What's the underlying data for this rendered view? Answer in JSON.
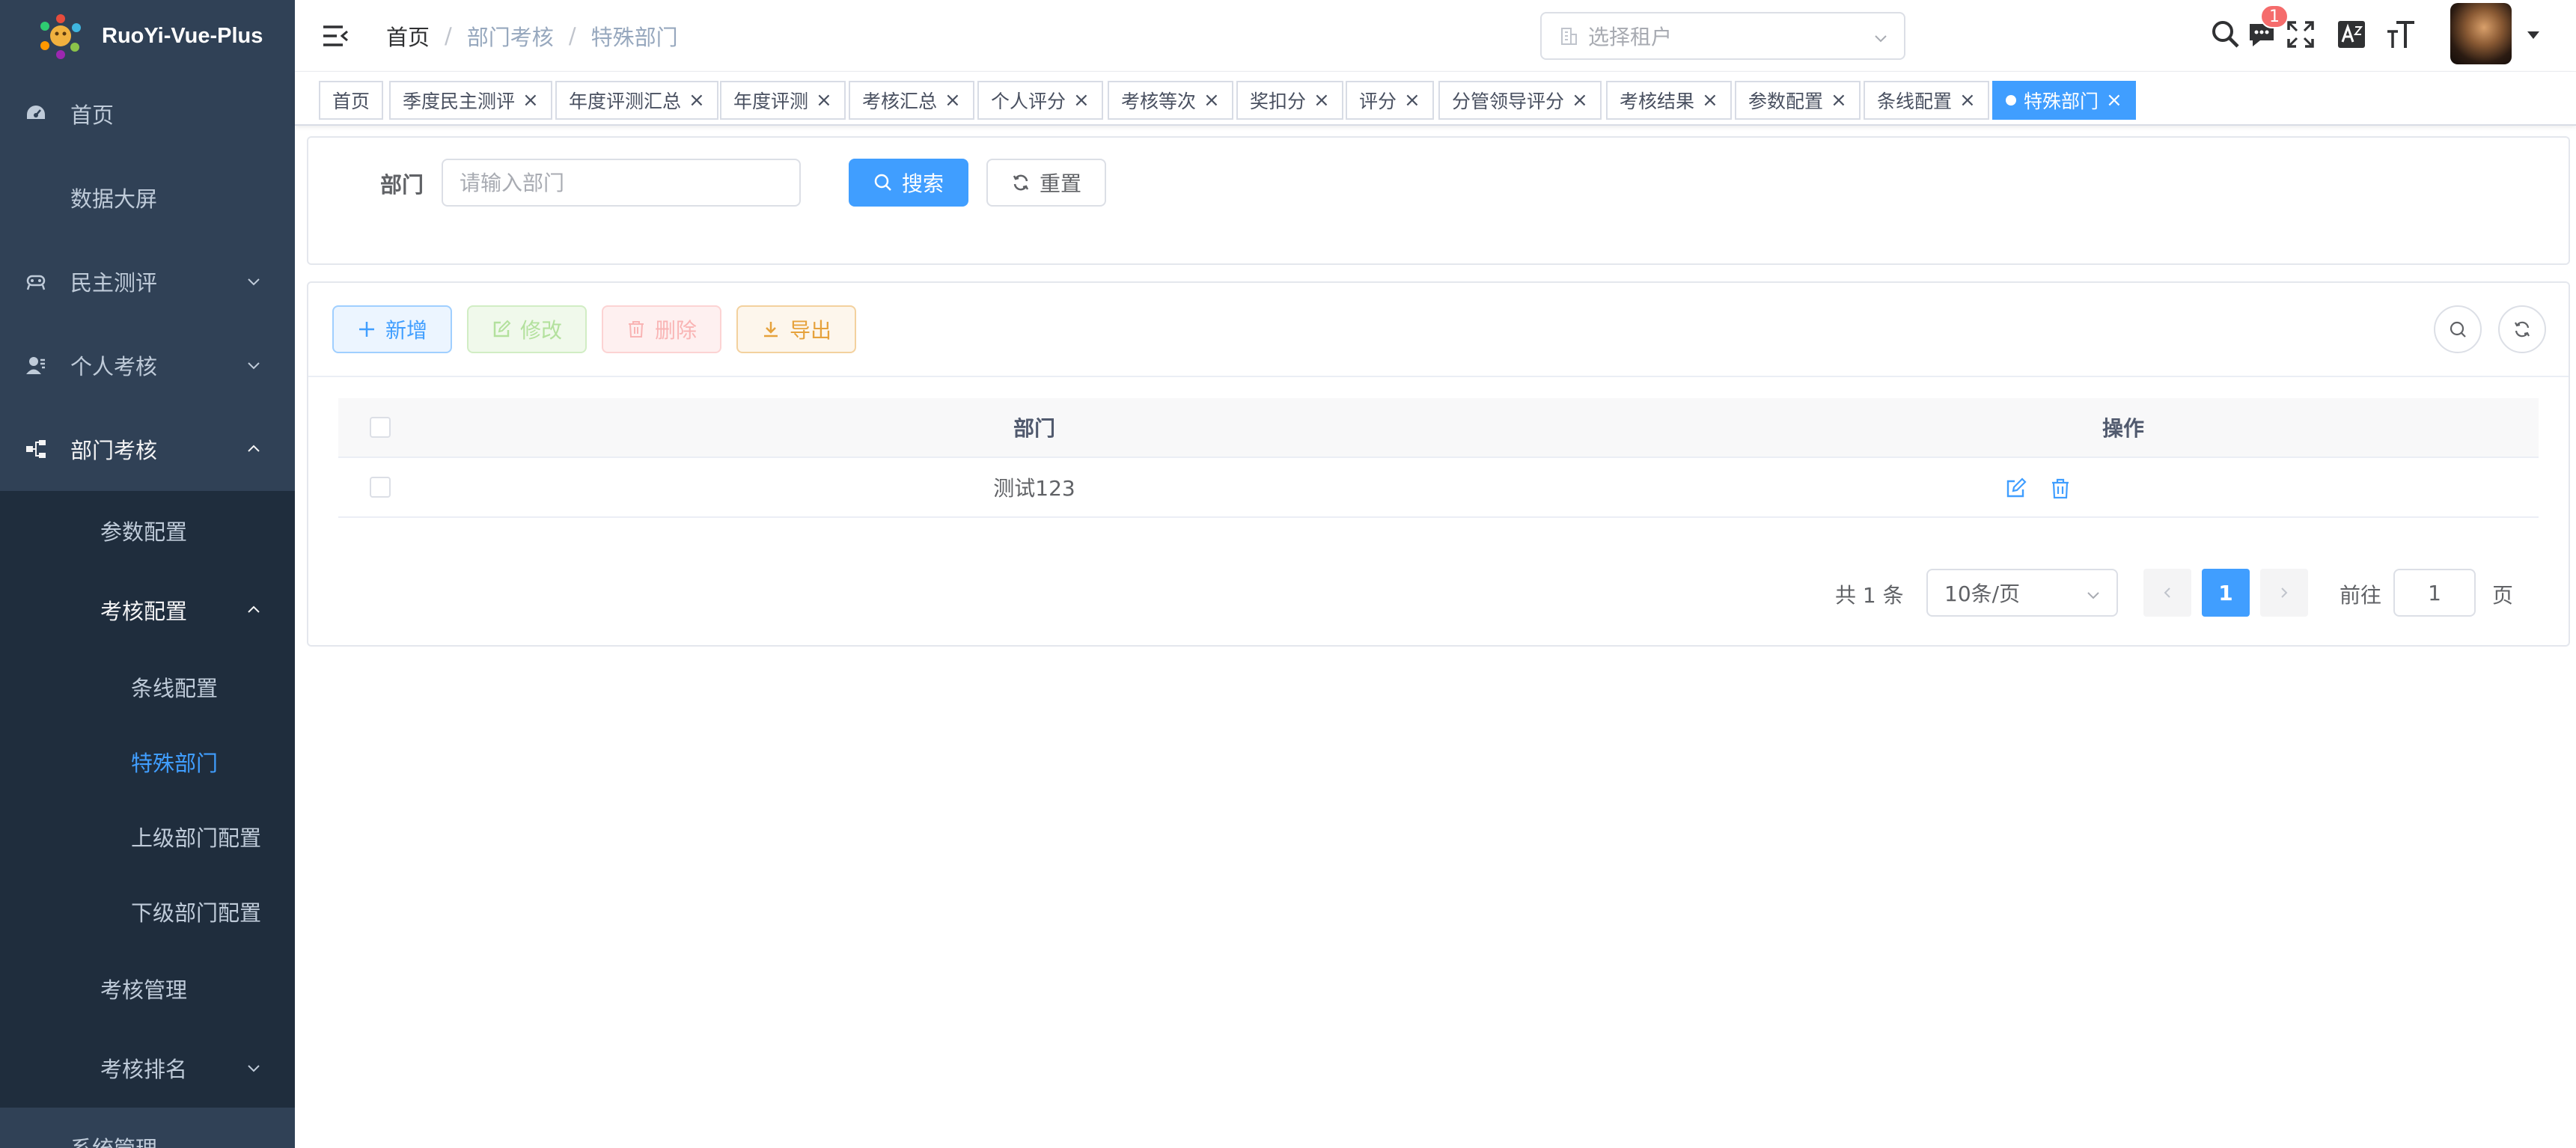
{
  "app": {
    "name": "RuoYi-Vue-Plus"
  },
  "sidebar": {
    "items": [
      {
        "label": "首页",
        "icon": "dashboard-icon"
      },
      {
        "label": "数据大屏"
      },
      {
        "label": "民主测评",
        "icon": "people-icon"
      },
      {
        "label": "个人考核",
        "icon": "user-icon"
      },
      {
        "label": "部门考核",
        "icon": "tree-icon"
      }
    ],
    "dept_sub": [
      {
        "label": "参数配置"
      },
      {
        "label": "考核配置"
      }
    ],
    "config_sub": [
      {
        "label": "条线配置"
      },
      {
        "label": "特殊部门"
      },
      {
        "label": "上级部门配置"
      },
      {
        "label": "下级部门配置"
      }
    ],
    "more_sub": [
      {
        "label": "考核管理"
      },
      {
        "label": "考核排名"
      }
    ],
    "bottom_item": {
      "label": "系统管理"
    }
  },
  "navbar": {
    "breadcrumb": [
      "首页",
      "部门考核",
      "特殊部门"
    ],
    "breadcrumb_sep": "/",
    "tenant_placeholder": "选择租户",
    "message_count": "1"
  },
  "tags": [
    "首页",
    "季度民主测评",
    "年度评测汇总",
    "年度评测",
    "考核汇总",
    "个人评分",
    "考核等次",
    "奖扣分",
    "评分",
    "分管领导评分",
    "考核结果",
    "参数配置",
    "条线配置",
    "特殊部门"
  ],
  "tag_close": "×",
  "search": {
    "label": "部门",
    "placeholder": "请输入部门",
    "search_button": "搜索",
    "reset_button": "重置"
  },
  "toolbar": {
    "add": "新增",
    "edit": "修改",
    "delete": "删除",
    "export": "导出"
  },
  "table": {
    "headers": {
      "dept": "部门",
      "op": "操作"
    },
    "rows": [
      {
        "dept": "测试123"
      }
    ]
  },
  "pagination": {
    "total": "共 1 条",
    "page_size": "10条/页",
    "current_page": "1",
    "goto_label": "前往",
    "goto_value": "1",
    "page_suffix": "页"
  },
  "colors": {
    "sidebar_bg": "#304156",
    "submenu_bg": "#1f2d3d",
    "primary": "#409eff",
    "sidebar_text": "#bfcbd9"
  }
}
